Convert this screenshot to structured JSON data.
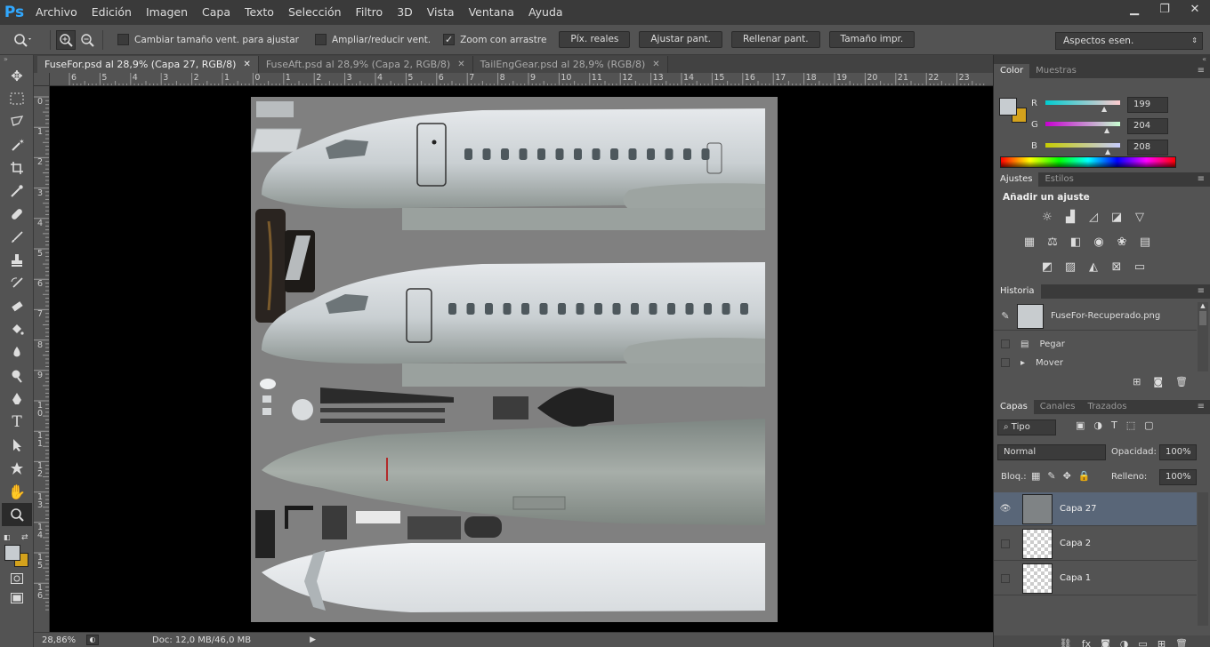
{
  "app": {
    "logo": "Ps"
  },
  "menu": [
    "Archivo",
    "Edición",
    "Imagen",
    "Capa",
    "Texto",
    "Selección",
    "Filtro",
    "3D",
    "Vista",
    "Ventana",
    "Ayuda"
  ],
  "window_controls": {
    "minimize": "▁",
    "restore": "❐",
    "close": "✕"
  },
  "options": {
    "resize_windows": {
      "label": "Cambiar tamaño vent. para ajustar",
      "checked": false
    },
    "zoom_all": {
      "label": "Ampliar/reducir vent.",
      "checked": false
    },
    "scrubby_zoom": {
      "label": "Zoom con arrastre",
      "checked": true
    },
    "btn_actual": "Píx. reales",
    "btn_fit": "Ajustar pant.",
    "btn_fill": "Rellenar pant.",
    "btn_print": "Tamaño impr.",
    "workspace": "Aspectos esen."
  },
  "tabs": [
    {
      "label": "FuseFor.psd al 28,9% (Capa 27, RGB/8)",
      "active": true
    },
    {
      "label": "FuseAft.psd al 28,9% (Capa 2, RGB/8)",
      "active": false
    },
    {
      "label": "TailEngGear.psd al 28,9% (RGB/8)",
      "active": false
    }
  ],
  "ruler_top": [
    "6",
    "5",
    "4",
    "3",
    "2",
    "1",
    "0",
    "1",
    "2",
    "3",
    "4",
    "5",
    "6",
    "7",
    "8",
    "9",
    "10",
    "11",
    "12",
    "13",
    "14",
    "15",
    "16",
    "17",
    "18",
    "19",
    "20",
    "21",
    "22",
    "23"
  ],
  "ruler_left": [
    "0",
    "1",
    "2",
    "3",
    "4",
    "5",
    "6",
    "7",
    "8",
    "9",
    "1\n0",
    "1\n1",
    "1\n2",
    "1\n3",
    "1\n4",
    "1\n5",
    "1\n6"
  ],
  "status": {
    "zoom": "28,86%",
    "doc": "Doc: 12,0 MB/46,0 MB"
  },
  "color_panel": {
    "tabs": [
      "Color",
      "Muestras"
    ],
    "r_label": "R",
    "g_label": "G",
    "b_label": "B",
    "r": "199",
    "g": "204",
    "b": "208",
    "fg": "#c7ccd0",
    "bg": "#d4a21c"
  },
  "adjust_panel": {
    "tabs": [
      "Ajustes",
      "Estilos"
    ],
    "title": "Añadir un ajuste"
  },
  "history_panel": {
    "tab": "Historia",
    "snapshot": "FuseFor-Recuperado.png",
    "items": [
      "Pegar",
      "Mover"
    ]
  },
  "layers_panel": {
    "tabs": [
      "Capas",
      "Canales",
      "Trazados"
    ],
    "filter": "Tipo",
    "blend": "Normal",
    "opacity_label": "Opacidad:",
    "opacity": "100%",
    "lock_label": "Bloq.:",
    "fill_label": "Relleno:",
    "fill": "100%",
    "layers": [
      {
        "name": "Capa 27",
        "visible": true,
        "selected": true
      },
      {
        "name": "Capa 2",
        "visible": false,
        "selected": false
      },
      {
        "name": "Capa 1",
        "visible": false,
        "selected": false
      }
    ]
  }
}
